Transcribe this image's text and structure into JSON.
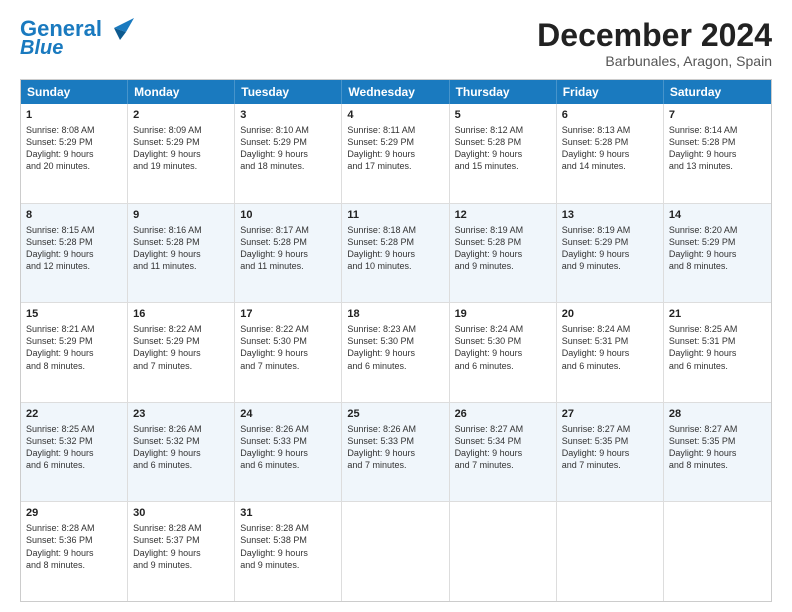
{
  "header": {
    "logo_line1": "General",
    "logo_line2": "Blue",
    "month_title": "December 2024",
    "subtitle": "Barbunales, Aragon, Spain"
  },
  "weekdays": [
    "Sunday",
    "Monday",
    "Tuesday",
    "Wednesday",
    "Thursday",
    "Friday",
    "Saturday"
  ],
  "rows": [
    [
      {
        "day": "1",
        "lines": [
          "Sunrise: 8:08 AM",
          "Sunset: 5:29 PM",
          "Daylight: 9 hours",
          "and 20 minutes."
        ]
      },
      {
        "day": "2",
        "lines": [
          "Sunrise: 8:09 AM",
          "Sunset: 5:29 PM",
          "Daylight: 9 hours",
          "and 19 minutes."
        ]
      },
      {
        "day": "3",
        "lines": [
          "Sunrise: 8:10 AM",
          "Sunset: 5:29 PM",
          "Daylight: 9 hours",
          "and 18 minutes."
        ]
      },
      {
        "day": "4",
        "lines": [
          "Sunrise: 8:11 AM",
          "Sunset: 5:29 PM",
          "Daylight: 9 hours",
          "and 17 minutes."
        ]
      },
      {
        "day": "5",
        "lines": [
          "Sunrise: 8:12 AM",
          "Sunset: 5:28 PM",
          "Daylight: 9 hours",
          "and 15 minutes."
        ]
      },
      {
        "day": "6",
        "lines": [
          "Sunrise: 8:13 AM",
          "Sunset: 5:28 PM",
          "Daylight: 9 hours",
          "and 14 minutes."
        ]
      },
      {
        "day": "7",
        "lines": [
          "Sunrise: 8:14 AM",
          "Sunset: 5:28 PM",
          "Daylight: 9 hours",
          "and 13 minutes."
        ]
      }
    ],
    [
      {
        "day": "8",
        "lines": [
          "Sunrise: 8:15 AM",
          "Sunset: 5:28 PM",
          "Daylight: 9 hours",
          "and 12 minutes."
        ]
      },
      {
        "day": "9",
        "lines": [
          "Sunrise: 8:16 AM",
          "Sunset: 5:28 PM",
          "Daylight: 9 hours",
          "and 11 minutes."
        ]
      },
      {
        "day": "10",
        "lines": [
          "Sunrise: 8:17 AM",
          "Sunset: 5:28 PM",
          "Daylight: 9 hours",
          "and 11 minutes."
        ]
      },
      {
        "day": "11",
        "lines": [
          "Sunrise: 8:18 AM",
          "Sunset: 5:28 PM",
          "Daylight: 9 hours",
          "and 10 minutes."
        ]
      },
      {
        "day": "12",
        "lines": [
          "Sunrise: 8:19 AM",
          "Sunset: 5:28 PM",
          "Daylight: 9 hours",
          "and 9 minutes."
        ]
      },
      {
        "day": "13",
        "lines": [
          "Sunrise: 8:19 AM",
          "Sunset: 5:29 PM",
          "Daylight: 9 hours",
          "and 9 minutes."
        ]
      },
      {
        "day": "14",
        "lines": [
          "Sunrise: 8:20 AM",
          "Sunset: 5:29 PM",
          "Daylight: 9 hours",
          "and 8 minutes."
        ]
      }
    ],
    [
      {
        "day": "15",
        "lines": [
          "Sunrise: 8:21 AM",
          "Sunset: 5:29 PM",
          "Daylight: 9 hours",
          "and 8 minutes."
        ]
      },
      {
        "day": "16",
        "lines": [
          "Sunrise: 8:22 AM",
          "Sunset: 5:29 PM",
          "Daylight: 9 hours",
          "and 7 minutes."
        ]
      },
      {
        "day": "17",
        "lines": [
          "Sunrise: 8:22 AM",
          "Sunset: 5:30 PM",
          "Daylight: 9 hours",
          "and 7 minutes."
        ]
      },
      {
        "day": "18",
        "lines": [
          "Sunrise: 8:23 AM",
          "Sunset: 5:30 PM",
          "Daylight: 9 hours",
          "and 6 minutes."
        ]
      },
      {
        "day": "19",
        "lines": [
          "Sunrise: 8:24 AM",
          "Sunset: 5:30 PM",
          "Daylight: 9 hours",
          "and 6 minutes."
        ]
      },
      {
        "day": "20",
        "lines": [
          "Sunrise: 8:24 AM",
          "Sunset: 5:31 PM",
          "Daylight: 9 hours",
          "and 6 minutes."
        ]
      },
      {
        "day": "21",
        "lines": [
          "Sunrise: 8:25 AM",
          "Sunset: 5:31 PM",
          "Daylight: 9 hours",
          "and 6 minutes."
        ]
      }
    ],
    [
      {
        "day": "22",
        "lines": [
          "Sunrise: 8:25 AM",
          "Sunset: 5:32 PM",
          "Daylight: 9 hours",
          "and 6 minutes."
        ]
      },
      {
        "day": "23",
        "lines": [
          "Sunrise: 8:26 AM",
          "Sunset: 5:32 PM",
          "Daylight: 9 hours",
          "and 6 minutes."
        ]
      },
      {
        "day": "24",
        "lines": [
          "Sunrise: 8:26 AM",
          "Sunset: 5:33 PM",
          "Daylight: 9 hours",
          "and 6 minutes."
        ]
      },
      {
        "day": "25",
        "lines": [
          "Sunrise: 8:26 AM",
          "Sunset: 5:33 PM",
          "Daylight: 9 hours",
          "and 7 minutes."
        ]
      },
      {
        "day": "26",
        "lines": [
          "Sunrise: 8:27 AM",
          "Sunset: 5:34 PM",
          "Daylight: 9 hours",
          "and 7 minutes."
        ]
      },
      {
        "day": "27",
        "lines": [
          "Sunrise: 8:27 AM",
          "Sunset: 5:35 PM",
          "Daylight: 9 hours",
          "and 7 minutes."
        ]
      },
      {
        "day": "28",
        "lines": [
          "Sunrise: 8:27 AM",
          "Sunset: 5:35 PM",
          "Daylight: 9 hours",
          "and 8 minutes."
        ]
      }
    ],
    [
      {
        "day": "29",
        "lines": [
          "Sunrise: 8:28 AM",
          "Sunset: 5:36 PM",
          "Daylight: 9 hours",
          "and 8 minutes."
        ]
      },
      {
        "day": "30",
        "lines": [
          "Sunrise: 8:28 AM",
          "Sunset: 5:37 PM",
          "Daylight: 9 hours",
          "and 9 minutes."
        ]
      },
      {
        "day": "31",
        "lines": [
          "Sunrise: 8:28 AM",
          "Sunset: 5:38 PM",
          "Daylight: 9 hours",
          "and 9 minutes."
        ]
      },
      {
        "day": "",
        "lines": []
      },
      {
        "day": "",
        "lines": []
      },
      {
        "day": "",
        "lines": []
      },
      {
        "day": "",
        "lines": []
      }
    ]
  ]
}
